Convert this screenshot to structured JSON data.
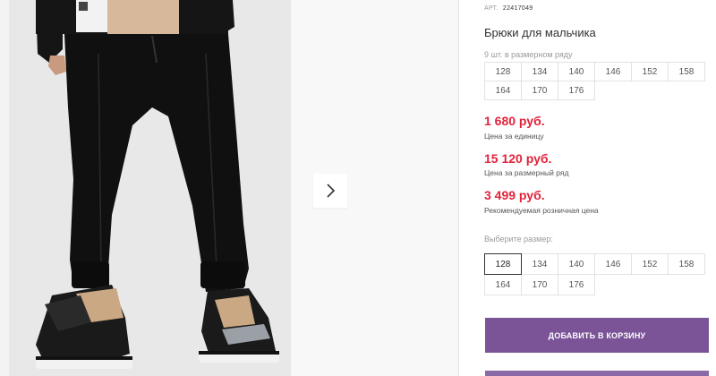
{
  "product": {
    "article_label": "АРТ.",
    "article_value": "22417049",
    "title": "Брюки для мальчика",
    "size_row_label": "9 шт. в размерном ряду",
    "size_row": [
      "128",
      "134",
      "140",
      "146",
      "152",
      "158",
      "164",
      "170",
      "176"
    ]
  },
  "prices": [
    {
      "value": "1 680 руб.",
      "caption": "Цена за единицу"
    },
    {
      "value": "15 120 руб.",
      "caption": "Цена за размерный ряд"
    },
    {
      "value": "3 499 руб.",
      "caption": "Рекомендуемая розничная цена"
    }
  ],
  "size_picker": {
    "label": "Выберите размер:",
    "sizes": [
      "128",
      "134",
      "140",
      "146",
      "152",
      "158",
      "164",
      "170",
      "176"
    ],
    "selected": "128"
  },
  "cart": {
    "add_label": "ДОБАВИТЬ В КОРЗИНУ"
  },
  "colors": {
    "price": "#e1233a",
    "button": "#7a5497"
  },
  "icons": {
    "next": "chevron-right-icon"
  }
}
